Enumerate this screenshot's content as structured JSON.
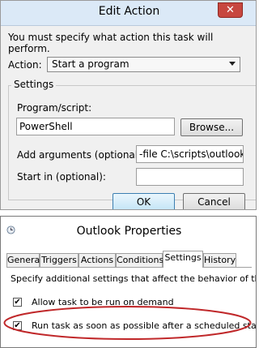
{
  "edit_action": {
    "title": "Edit Action",
    "close_symbol": "✕",
    "instruction": "You must specify what action this task will perform.",
    "action_label": "Action:",
    "action_value": "Start a program",
    "settings_label": "Settings",
    "program_label": "Program/script:",
    "program_value": "PowerShell",
    "browse_label": "Browse...",
    "args_label": "Add arguments (optional):",
    "args_value": "-file C:\\scripts\\outlook",
    "start_in_label": "Start in (optional):",
    "start_in_value": "",
    "ok_label": "OK",
    "cancel_label": "Cancel"
  },
  "properties": {
    "title": "Outlook Properties",
    "tabs": [
      "General",
      "Triggers",
      "Actions",
      "Conditions",
      "Settings",
      "History"
    ],
    "active_tab": "Settings",
    "description": "Specify additional settings that affect the behavior of the task.",
    "checkboxes": [
      {
        "label": "Allow task to be run on demand",
        "checked": true
      },
      {
        "label": "Run task as soon as possible after a scheduled start is missed",
        "checked": true
      }
    ]
  },
  "colors": {
    "highlight_ellipse": "#c0282a",
    "titlebar": "#dbe9f7",
    "close_button": "#c7473f"
  }
}
